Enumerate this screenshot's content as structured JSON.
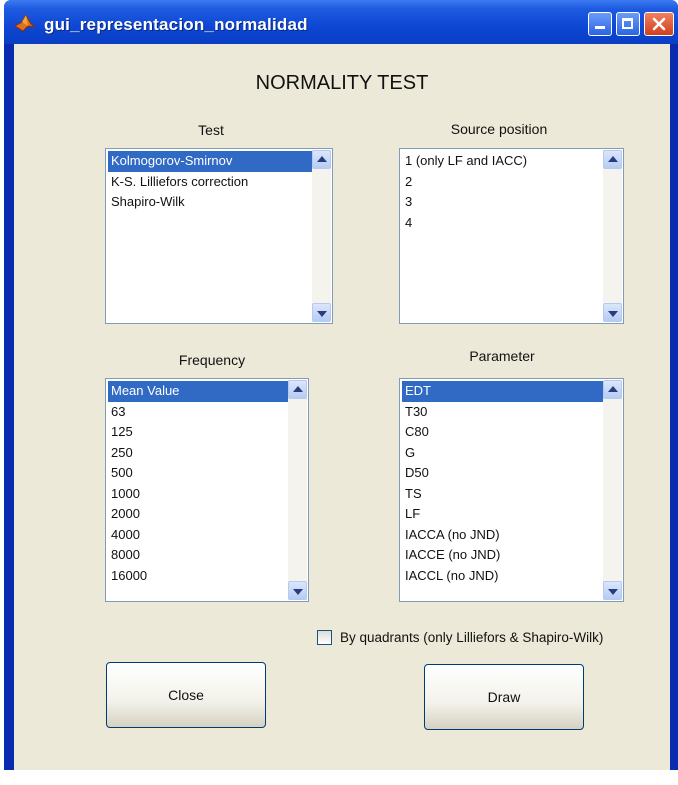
{
  "window": {
    "title": "gui_representacion_normalidad",
    "controls": {
      "minimize": "minimize-icon",
      "maximize": "maximize-icon",
      "close": "close-icon"
    }
  },
  "heading": "NORMALITY TEST",
  "test": {
    "label": "Test",
    "items": [
      "Kolmogorov-Smirnov",
      "K-S. Lilliefors correction",
      "Shapiro-Wilk"
    ],
    "selected_index": 0
  },
  "source_position": {
    "label": "Source position",
    "items": [
      "1 (only LF and IACC)",
      "2",
      "3",
      "4"
    ]
  },
  "frequency": {
    "label": "Frequency",
    "items": [
      "Mean Value",
      "63",
      "125",
      "250",
      "500",
      "1000",
      "2000",
      "4000",
      "8000",
      "16000"
    ],
    "selected_index": 0
  },
  "parameter": {
    "label": "Parameter",
    "items": [
      "EDT",
      "T30",
      "C80",
      "G",
      "D50",
      "TS",
      "LF",
      "IACCA (no JND)",
      "IACCE (no JND)",
      "IACCL (no JND)"
    ],
    "selected_index": 0
  },
  "quadrants": {
    "label": "By quadrants (only Lilliefors & Shapiro-Wilk)",
    "checked": false
  },
  "buttons": {
    "close": "Close",
    "draw": "Draw"
  },
  "colors": {
    "selection": "#316ac5",
    "titlebar": "#0d47d4",
    "panel": "#ece9d8"
  }
}
